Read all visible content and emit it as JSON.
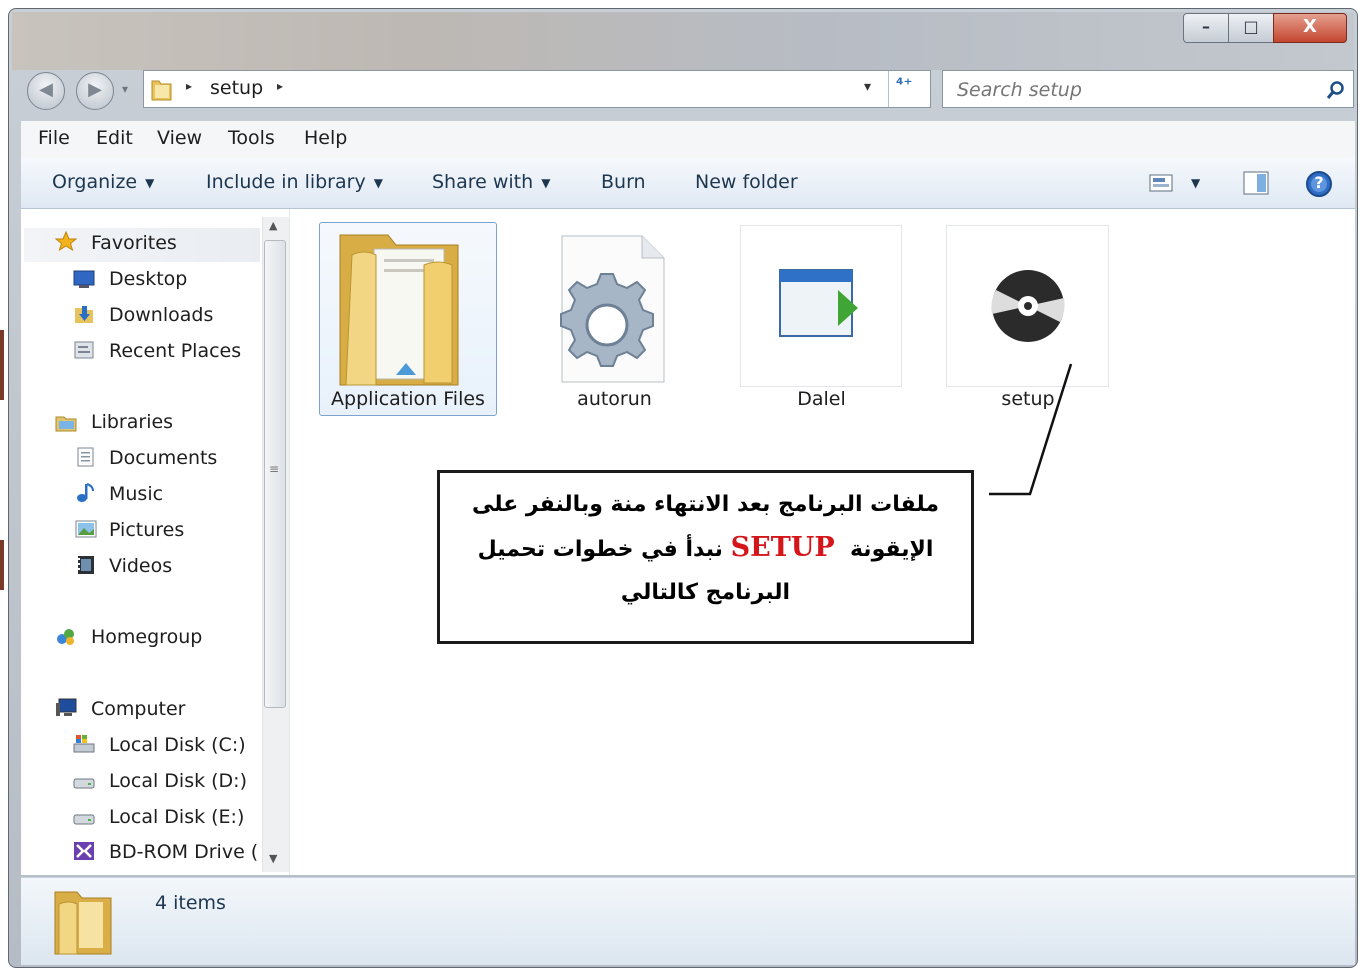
{
  "window": {
    "caption_buttons": {
      "minimize": "–",
      "maximize": "□",
      "close": "X"
    }
  },
  "navigation": {
    "back_arrow": "◀",
    "forward_arrow": "▶",
    "recent_arrow": "▾",
    "breadcrumb": [
      "setup"
    ],
    "breadcrumb_sep": "▸",
    "history_dropdown": "▾",
    "refresh_glyph": "⁴⁺"
  },
  "search": {
    "placeholder": "Search setup",
    "icon": "search-icon"
  },
  "menu_bar": [
    "File",
    "Edit",
    "View",
    "Tools",
    "Help"
  ],
  "command_bar": {
    "organize": "Organize",
    "include_in_library": "Include in library",
    "share_with": "Share with",
    "burn": "Burn",
    "new_folder": "New folder",
    "dropdown_caret": "▼",
    "views_icon": "views-icon",
    "preview_pane_icon": "preview-pane-icon",
    "help_icon": "help-icon",
    "help_glyph": "?"
  },
  "nav_pane": {
    "favorites": {
      "label": "Favorites",
      "items": [
        "Desktop",
        "Downloads",
        "Recent Places"
      ]
    },
    "libraries": {
      "label": "Libraries",
      "items": [
        "Documents",
        "Music",
        "Pictures",
        "Videos"
      ]
    },
    "homegroup": {
      "label": "Homegroup"
    },
    "computer": {
      "label": "Computer",
      "items": [
        "Local Disk (C:)",
        "Local Disk (D:)",
        "Local Disk (E:)",
        "BD-ROM Drive (C"
      ]
    },
    "scroll_up": "▲",
    "scroll_down": "▼",
    "scroll_grip": "≡"
  },
  "files": [
    {
      "name": "Application Files",
      "icon": "folder-icon",
      "selected": true
    },
    {
      "name": "autorun",
      "icon": "settings-file-icon",
      "selected": false
    },
    {
      "name": "Dalel",
      "icon": "application-icon",
      "selected": false
    },
    {
      "name": "setup",
      "icon": "setup-disc-icon",
      "selected": false
    }
  ],
  "annotation": {
    "line1": "ملفات البرنامج بعد الانتهاء منة وبالنفر على",
    "line2_start": "الإيقونة",
    "keyword": "SETUP",
    "line2_end": "نبدأ في خطوات تحميل",
    "line3": "البرنامج كالتالي",
    "keyword_color": "#d4161b"
  },
  "status_bar": {
    "item_count": "4 items",
    "icon": "folder-icon"
  }
}
